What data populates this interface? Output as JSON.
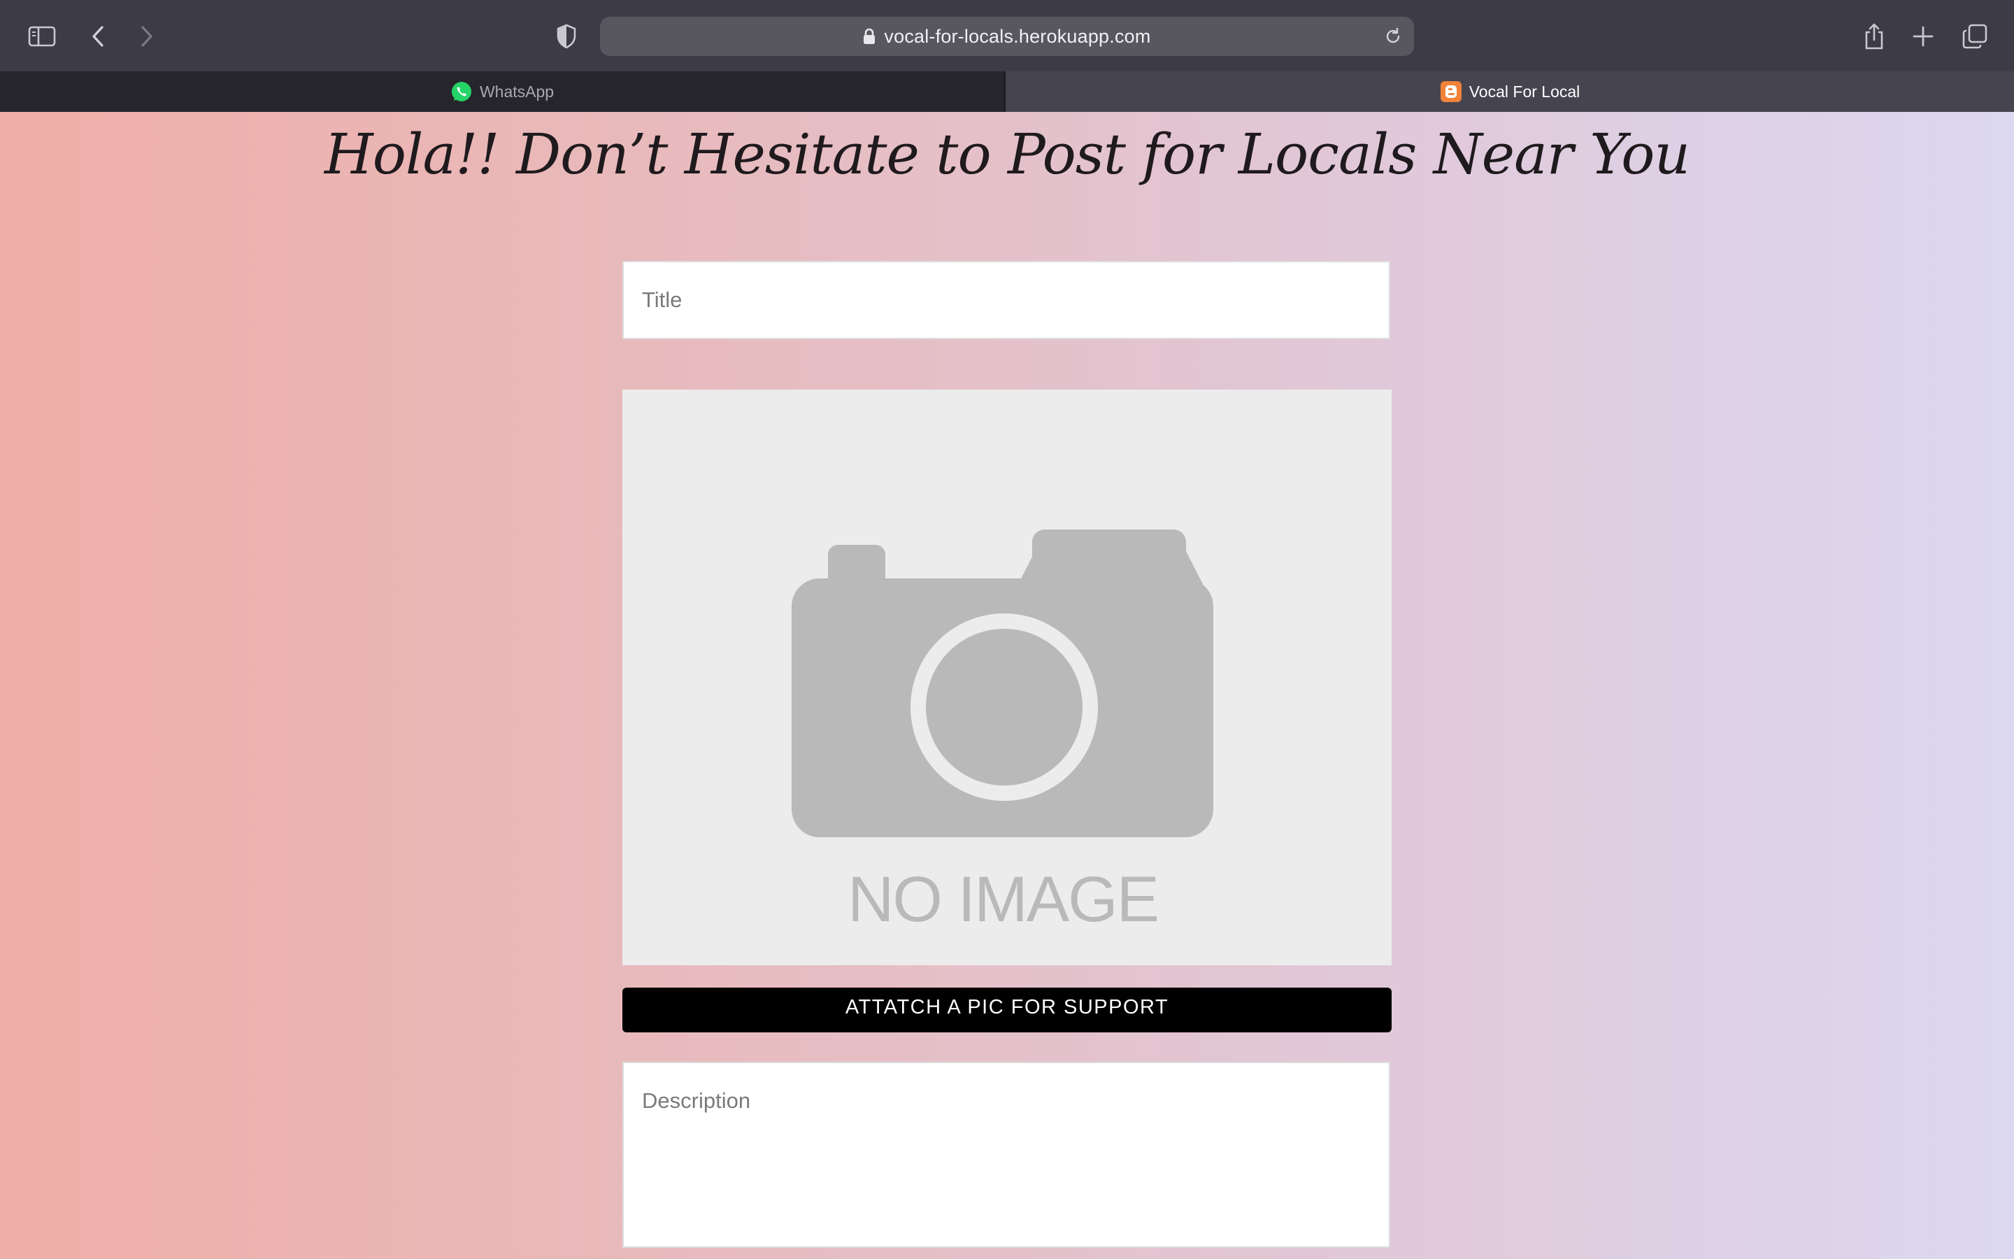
{
  "browser": {
    "url": "vocal-for-locals.herokuapp.com",
    "tabs": [
      {
        "label": "WhatsApp",
        "active": false,
        "favicon": "whatsapp-icon"
      },
      {
        "label": "Vocal For Local",
        "active": true,
        "favicon": "blogger-icon"
      }
    ],
    "icons": {
      "sidebar": "sidebar-icon",
      "back": "chevron-left-icon",
      "forward": "chevron-right-icon",
      "privacy": "shield-icon",
      "lock": "lock-icon",
      "reload": "reload-icon",
      "share": "share-icon",
      "new_tab": "plus-icon",
      "tab_overview": "tabs-overview-icon"
    }
  },
  "page": {
    "heading": "Hola!! Don’t Hesitate to Post for Locals Near You",
    "title_placeholder": "Title",
    "image_placeholder_text": "NO IMAGE",
    "attach_button_label": "ATTATCH A PIC FOR SUPPORT",
    "description_placeholder": "Description"
  },
  "colors": {
    "toolbar": "#3d3b46",
    "gradient_left": "#efaea7",
    "gradient_right": "#dcd8f0",
    "button": "#000000",
    "whatsapp": "#25d366",
    "blogger": "#f0823a"
  }
}
